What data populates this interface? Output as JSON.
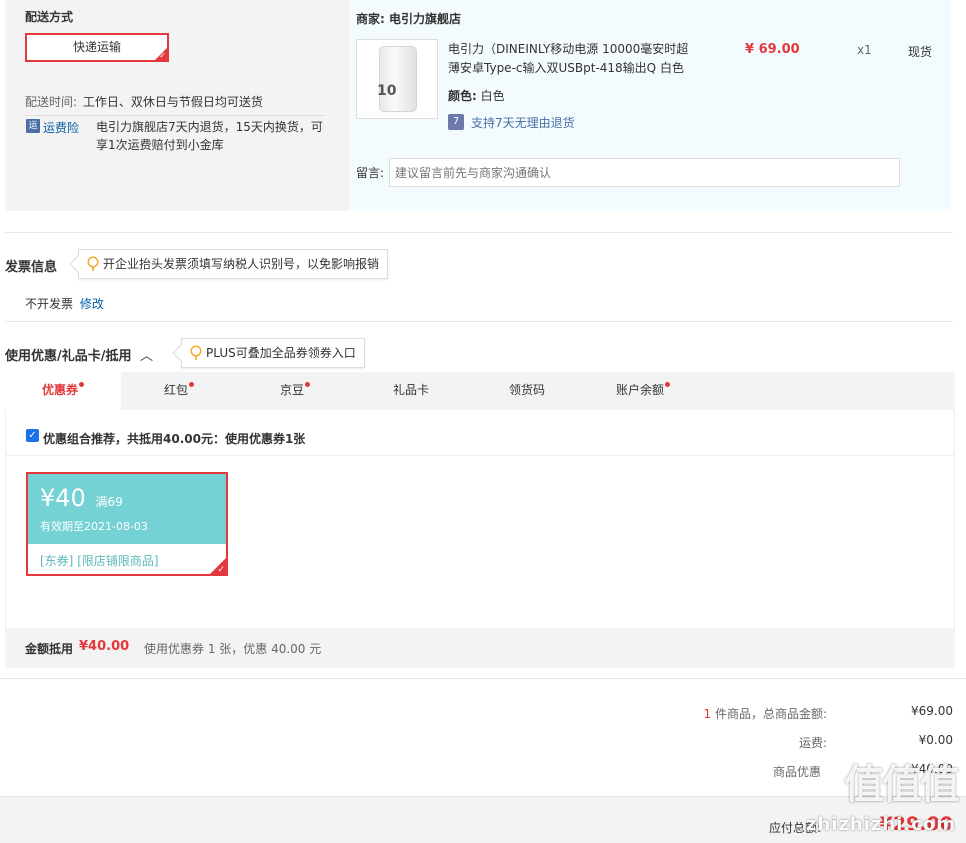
{
  "shipping": {
    "section_title": "配送方式",
    "method_label": "快递运输",
    "delivery_time_label": "配送时间:",
    "delivery_time_value": "工作日、双休日与节假日均可送货",
    "insurance_badge": "运",
    "insurance_label": "运费险",
    "insurance_desc_line1": "电引力旗舰店7天内退货，15天内换货，可",
    "insurance_desc_line2": "享1次运费赔付到小金库"
  },
  "store": {
    "label": "商家:",
    "name": "电引力旗舰店",
    "product": {
      "name_line1": "电引力（DINEINLY移动电源 10000毫安时超",
      "name_line2": "薄安卓Type-c输入双USBpt-418输出Q 白色",
      "price": "¥ 69.00",
      "quantity": "x1",
      "stock": "现货",
      "color_label": "颜色:",
      "color_value": "白色",
      "return_badge": "7",
      "return_policy": "支持7天无理由退货",
      "thumb_text": "10"
    },
    "note_label": "留言:",
    "note_placeholder": "建议留言前先与商家沟通确认"
  },
  "invoice": {
    "title": "发票信息",
    "tip": "开企业抬头发票须填写纳税人识别号，以免影响报销",
    "status": "不开发票",
    "edit_link": "修改"
  },
  "discount": {
    "title": "使用优惠/礼品卡/抵用",
    "tip": "PLUS可叠加全品券领券入口",
    "tabs": [
      {
        "label": "优惠券",
        "dot": true
      },
      {
        "label": "红包",
        "dot": true
      },
      {
        "label": "京豆",
        "dot": true
      },
      {
        "label": "礼品卡",
        "dot": false
      },
      {
        "label": "领货码",
        "dot": false
      },
      {
        "label": "账户余额",
        "dot": true
      }
    ],
    "recommend_text": "优惠组合推荐，共抵用40.00元：使用优惠券1张",
    "coupon": {
      "amount": "¥40",
      "condition": "满69",
      "validity": "有效期至2021-08-03",
      "tag1": "[东券]",
      "tag2": "[限店铺限商品]"
    },
    "summary_label": "金额抵用",
    "summary_amount": "¥40.00",
    "summary_desc": "使用优惠券 1 张，优惠 40.00 元"
  },
  "totals": {
    "item_count": "1",
    "items_label": "件商品，总商品金额:",
    "items_amount": "¥69.00",
    "shipping_label": "运费:",
    "shipping_amount": "¥0.00",
    "discount_label": "商品优惠",
    "discount_amount": "-¥40.00",
    "payable_label": "应付总额:",
    "payable_amount": "¥29.00"
  },
  "watermark": {
    "logo": "值值值",
    "url": "zhizhizhi.com"
  },
  "colors": {
    "accent_red": "#e4393c",
    "link_blue": "#005ea7",
    "coupon_teal": "#74d2d4"
  }
}
